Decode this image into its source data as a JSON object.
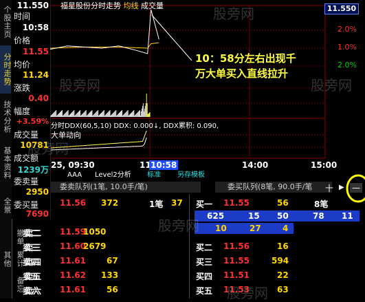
{
  "left_tabs": {
    "items": [
      {
        "label": "个股主页"
      },
      {
        "label": "分时走势"
      },
      {
        "label": "技术分析"
      },
      {
        "label": "基本资料"
      },
      {
        "label": "全景"
      },
      {
        "label": "撤单"
      },
      {
        "label": "累计"
      },
      {
        "label": "其他"
      },
      {
        "label": "备忘"
      }
    ]
  },
  "info": {
    "top_price": "11.550",
    "rows": [
      {
        "label": "时间",
        "value": "10:58"
      },
      {
        "label": "价格",
        "value": "11.55"
      },
      {
        "label": "均价",
        "value": "11.24"
      },
      {
        "label": "涨跌",
        "value": "0.40"
      },
      {
        "label": "幅度",
        "value": "+3.59%"
      },
      {
        "label": "成交量",
        "value": "10781"
      },
      {
        "label": "成交额",
        "value": "1239万"
      },
      {
        "label": "委卖量",
        "value": "2950"
      },
      {
        "label": "委买量",
        "value": "7690"
      }
    ]
  },
  "chart": {
    "title_stock": "福星股份分时走势",
    "title_avg": "均线",
    "title_vol": "成交量",
    "top_right_price": "11.550",
    "pct_labels": [
      "2.0%",
      "1.0%",
      "2.0%"
    ],
    "ddx_line": "分时DDX(60,5,10) DDX: 0.000↓, DDX累积: 0.090,",
    "big_order": "大单动向",
    "time_labels": [
      "25, 09:30",
      "11",
      "10:58",
      "14:00",
      "15:00"
    ],
    "annotation_line1": "10：58分左右出现千",
    "annotation_line2": "万大单买入直线拉升",
    "watermarks": [
      "股旁网",
      "股旁网",
      "股旁网",
      "股旁网",
      "股旁网",
      "股旁网"
    ],
    "watermark_text": "股旁网"
  },
  "chart_data": {
    "type": "line",
    "series": [
      {
        "name": "price",
        "x": [
          "09:30",
          "09:45",
          "10:00",
          "10:15",
          "10:30",
          "10:45",
          "10:55",
          "10:58",
          "11:05"
        ],
        "values": [
          11.19,
          11.22,
          11.21,
          11.2,
          11.22,
          11.18,
          11.15,
          11.55,
          11.28
        ]
      },
      {
        "name": "avg",
        "x": [
          "09:30",
          "10:00",
          "10:30",
          "10:55",
          "10:58",
          "11:05"
        ],
        "values": [
          11.2,
          11.21,
          11.21,
          11.2,
          11.24,
          11.25
        ]
      }
    ]
  },
  "toolbar": {
    "tabs": [
      "AAA",
      "Level2分析",
      "标准",
      "另存模板"
    ]
  },
  "book": {
    "sell_header": "委卖队列(1笔, 10.0手/笔)",
    "buy_header": "委买队列(8笔, 90.0手/笔",
    "plus": "十",
    "minus": "—",
    "sell_queue": {
      "price": "11.56",
      "vol": "372",
      "count": "1笔",
      "extra": "37"
    },
    "sell_rows": [
      {
        "label": "卖二",
        "price": "11.59",
        "vol": "1050"
      },
      {
        "label": "卖三",
        "price": "11.60",
        "vol": "2679"
      },
      {
        "label": "卖四",
        "price": "11.61",
        "vol": "67"
      },
      {
        "label": "卖五",
        "price": "11.62",
        "vol": "133"
      },
      {
        "label": "卖六",
        "price": "11.61",
        "vol": "56"
      }
    ],
    "buy_one": {
      "label": "买一",
      "price": "11.55",
      "vol": "56",
      "count": "8笔"
    },
    "queue_row1": [
      "625",
      "15",
      "50",
      "78",
      "11"
    ],
    "queue_row2": [
      "10",
      "27",
      "4"
    ],
    "buy_rows": [
      {
        "label": "买二",
        "price": "11.56",
        "vol": "16"
      },
      {
        "label": "买三",
        "price": "11.55",
        "vol": "594"
      },
      {
        "label": "买四",
        "price": "11.51",
        "vol": "22"
      },
      {
        "label": "买五",
        "price": "11.53",
        "vol": "63"
      }
    ]
  }
}
